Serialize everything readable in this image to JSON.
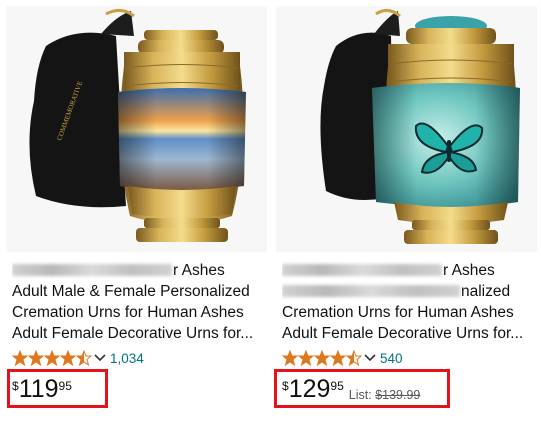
{
  "products": [
    {
      "title_lines": [
        "r Ashes",
        "Adult Male & Female Personalized",
        "Cremation Urns for Human Ashes",
        "Adult Female Decorative Urns for..."
      ],
      "rating_count": "1,034",
      "price": {
        "currency": "$",
        "whole": "119",
        "fraction": "95"
      },
      "list_label": "",
      "list_price": "",
      "urn_band": "sunset-beach",
      "rating": 4.5
    },
    {
      "title_lines": [
        "r Ashes",
        "nalized",
        "Cremation Urns for Human Ashes",
        "Adult Female Decorative Urns for..."
      ],
      "rating_count": "540",
      "price": {
        "currency": "$",
        "whole": "129",
        "fraction": "95"
      },
      "list_label": "List:",
      "list_price": "$139.99",
      "urn_band": "teal-butterfly",
      "rating": 4.5
    }
  ],
  "colors": {
    "highlight": "#e3121b",
    "star": "#de7921",
    "link": "#007185",
    "gold": "#c9a043"
  },
  "bag_text": "COMMEMORATIVE"
}
